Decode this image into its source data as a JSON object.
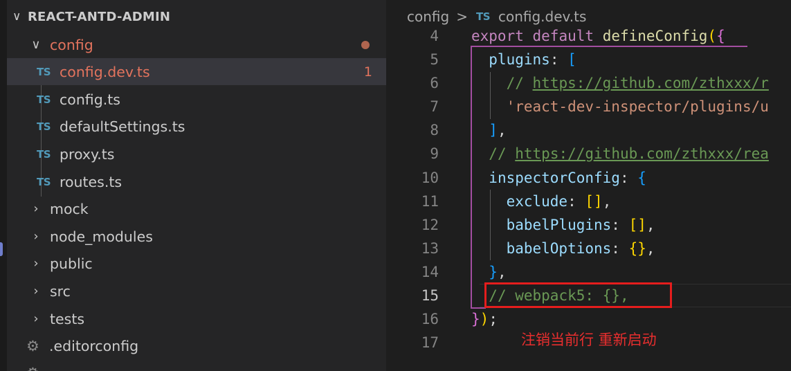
{
  "explorer": {
    "title": "REACT-ANTD-ADMIN",
    "items": [
      {
        "label": "config"
      },
      {
        "label": "config.dev.ts",
        "icon_text": "TS",
        "badge": "1"
      },
      {
        "label": "config.ts",
        "icon_text": "TS"
      },
      {
        "label": "defaultSettings.ts",
        "icon_text": "TS"
      },
      {
        "label": "proxy.ts",
        "icon_text": "TS"
      },
      {
        "label": "routes.ts",
        "icon_text": "TS"
      },
      {
        "label": "mock"
      },
      {
        "label": "node_modules"
      },
      {
        "label": "public"
      },
      {
        "label": "src"
      },
      {
        "label": "tests"
      },
      {
        "label": ".editorconfig"
      }
    ]
  },
  "breadcrumb": {
    "folder": "config",
    "separator": ">",
    "icon_text": "TS",
    "file": "config.dev.ts"
  },
  "editor": {
    "line_numbers": [
      "4",
      "5",
      "6",
      "7",
      "8",
      "9",
      "10",
      "11",
      "12",
      "13",
      "14",
      "15",
      "16",
      "17"
    ],
    "active_line": "15",
    "lines": {
      "l4": {
        "kw1": "export",
        "kw2": "default",
        "fn": "defineConfig",
        "p1": "(",
        "p2": "{"
      },
      "l5": {
        "prop": "plugins",
        "colon": ":",
        "br": "["
      },
      "l6": {
        "cmt": "//",
        "url": "https://github.com/zthxxx/r"
      },
      "l7": {
        "str": "'react-dev-inspector/plugins/u"
      },
      "l8": {
        "br": "]",
        "pun": ","
      },
      "l9": {
        "cmt": "//",
        "url": "https://github.com/zthxxx/rea"
      },
      "l10": {
        "prop": "inspectorConfig",
        "colon": ":",
        "br": "{"
      },
      "l11": {
        "prop": "exclude",
        "colon": ":",
        "br": "[]",
        "pun": ","
      },
      "l12": {
        "prop": "babelPlugins",
        "colon": ":",
        "br": "[]",
        "pun": ","
      },
      "l13": {
        "prop": "babelOptions",
        "colon": ":",
        "br": "{}",
        "pun": ","
      },
      "l14": {
        "br": "}",
        "pun": ","
      },
      "l15": {
        "cmt": "// webpack5: {},"
      },
      "l16": {
        "br1": "}",
        "br2": ")",
        "pun": ";"
      }
    }
  },
  "annotation": "注销当前行 重新启动",
  "colors": {
    "highlight_box": "#e51d1d",
    "annotation_text": "#e82e2e",
    "modified_file": "#e2735d"
  }
}
